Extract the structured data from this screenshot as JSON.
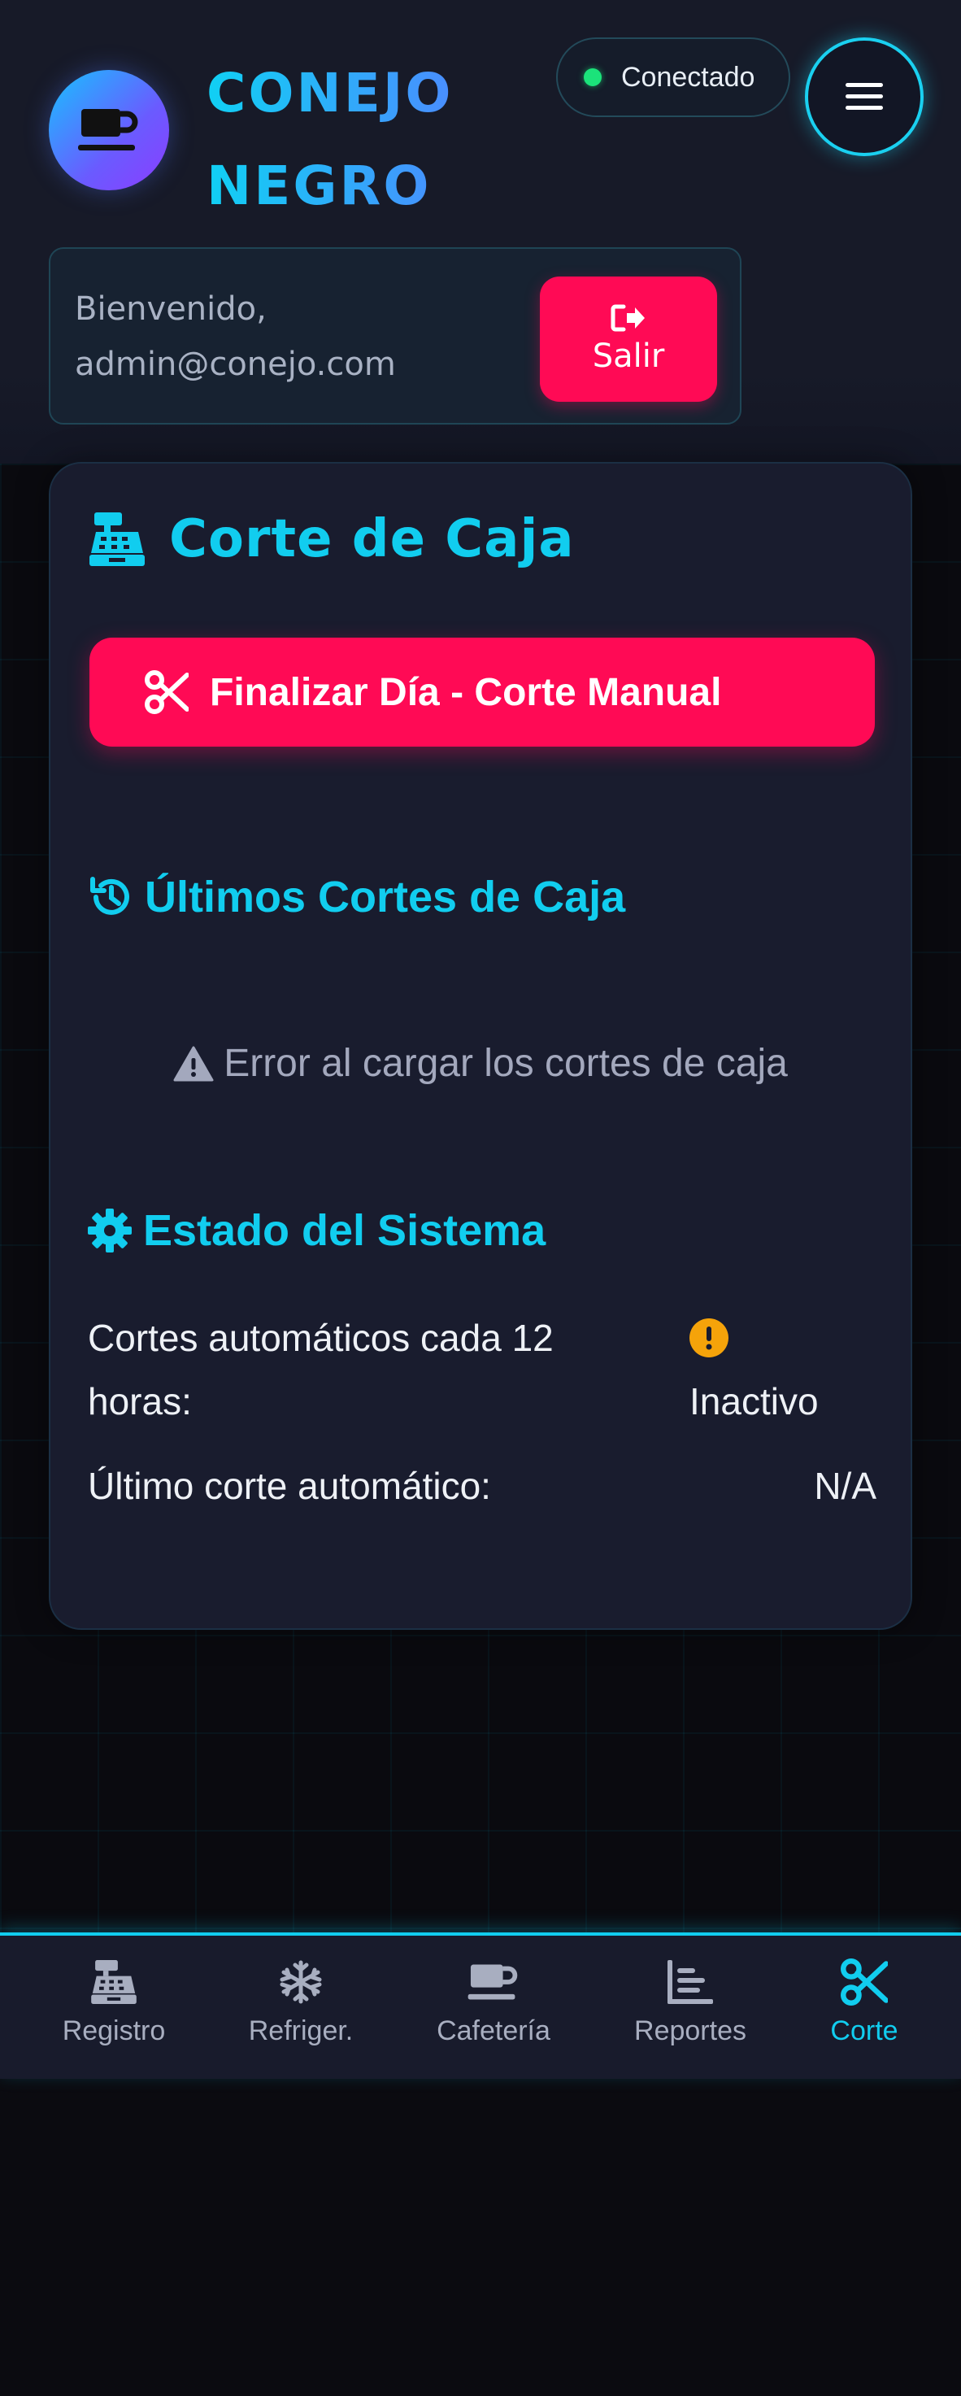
{
  "header": {
    "brand_line1": "CONEJO",
    "brand_line2": "NEGRO",
    "logo_icon": "coffee-cup-icon",
    "connection_status": "Conectado",
    "connection_color": "#1be37a",
    "menu_icon": "hamburger-menu-icon"
  },
  "user": {
    "welcome_line1": "Bienvenido,",
    "welcome_line2": "admin@conejo.com",
    "logout_label": "Salir",
    "logout_icon": "sign-out-icon"
  },
  "main": {
    "title": "Corte de Caja",
    "title_icon": "cash-register-icon",
    "finalize_label": "Finalizar Día - Corte Manual",
    "finalize_icon": "scissors-icon",
    "history_title": "Últimos Cortes de Caja",
    "history_icon": "history-icon",
    "history_error": "Error al cargar los cortes de caja",
    "history_error_icon": "warning-triangle-icon",
    "system_title": "Estado del Sistema",
    "system_icon": "gear-icon",
    "auto_label_line1": "Cortes automáticos cada 12",
    "auto_label_line2": "horas:",
    "auto_status": "Inactivo",
    "auto_status_icon": "exclamation-circle-icon",
    "last_auto_label": "Último corte automático:",
    "last_auto_value": "N/A"
  },
  "nav": {
    "items": [
      {
        "label": "Registro",
        "icon": "cash-register-icon",
        "active": false
      },
      {
        "label": "Refriger.",
        "icon": "snowflake-icon",
        "active": false
      },
      {
        "label": "Cafetería",
        "icon": "coffee-cup-icon",
        "active": false
      },
      {
        "label": "Reportes",
        "icon": "bar-chart-icon",
        "active": false
      },
      {
        "label": "Corte",
        "icon": "scissors-icon",
        "active": true
      }
    ]
  },
  "colors": {
    "accent": "#11cdef",
    "danger": "#ff0a55",
    "warning": "#f5a30a",
    "background": "#0b0b10",
    "card": "#191c2e"
  }
}
